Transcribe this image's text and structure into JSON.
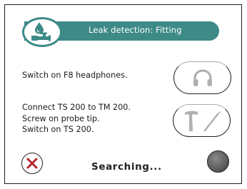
{
  "header": {
    "title": "Leak detection: Fitting",
    "icon": "water-drop-faucet-icon",
    "color": "#3d8a86"
  },
  "steps": [
    {
      "lines": [
        "Switch on F8 headphones."
      ],
      "button_icon": "headphones-icon"
    },
    {
      "lines": [
        "Connect TS 200 to TM 200.",
        "Screw on probe tip.",
        "Switch on TS 200."
      ],
      "button_icon": "probe-tools-icon"
    }
  ],
  "footer": {
    "cancel_icon": "cancel-x-icon",
    "cancel_color": "#b3262e",
    "status": "Searching...",
    "status_indicator_color": "#5a5a5a"
  }
}
